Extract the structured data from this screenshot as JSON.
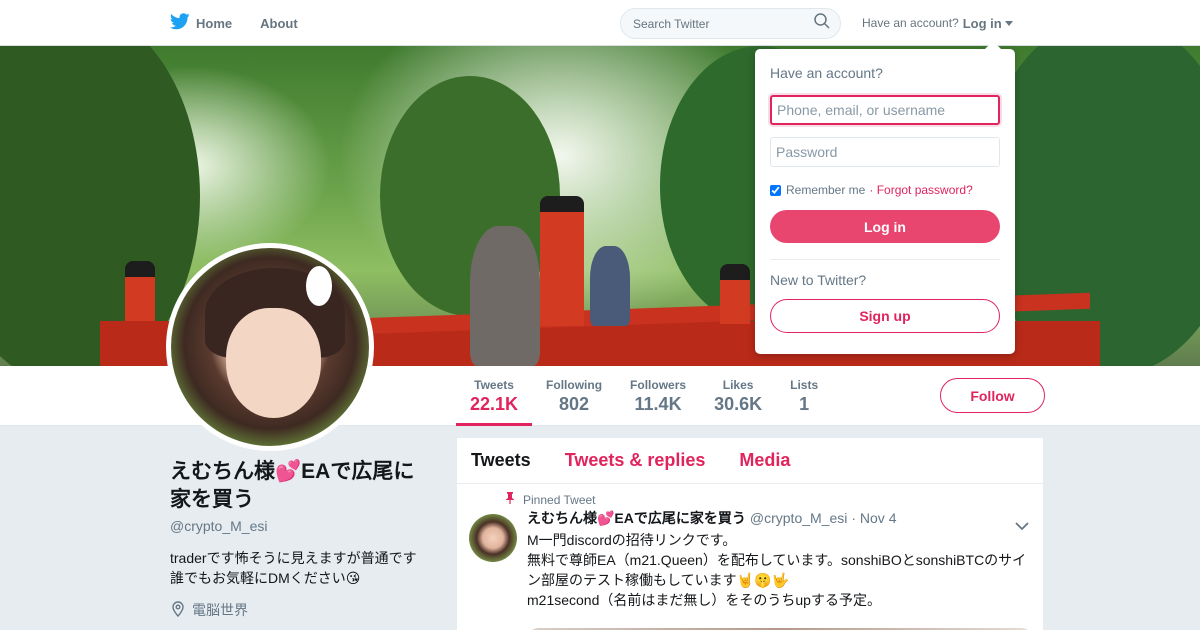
{
  "nav": {
    "home_label": "Home",
    "about_label": "About",
    "search_placeholder": "Search Twitter",
    "have_account_text": "Have an account?",
    "login_label": "Log in"
  },
  "colors": {
    "accent": "#e0245e",
    "brand_blue": "#1da1f2"
  },
  "icons": [
    "twitter-bird-icon",
    "search-icon",
    "caret-down-icon",
    "location-pin-icon",
    "pushpin-icon",
    "chevron-down-icon"
  ],
  "profile": {
    "name": "えむちん様💕EAで広尾に家を買う",
    "handle": "@crypto_M_esi",
    "bio": "traderです怖そうに見えますが普通です誰でもお気軽にDMください😘",
    "location": "電脳世界"
  },
  "stats": [
    {
      "label": "Tweets",
      "value": "22.1K"
    },
    {
      "label": "Following",
      "value": "802"
    },
    {
      "label": "Followers",
      "value": "11.4K"
    },
    {
      "label": "Likes",
      "value": "30.6K"
    },
    {
      "label": "Lists",
      "value": "1"
    }
  ],
  "follow_label": "Follow",
  "timeline": {
    "tabs": [
      "Tweets",
      "Tweets & replies",
      "Media"
    ],
    "pinned_label": "Pinned Tweet",
    "tweet": {
      "name": "えむちん様💕EAで広尾に家を買う",
      "handle": "@crypto_M_esi",
      "time": "· Nov 4",
      "text": "M一門discordの招待リンクです。\n無料で尊師EA（m21.Queen）を配布しています。sonshiBOとsonshiBTCのサイン部屋のテスト稼働もしています🤘🤫🤟\nm21second（名前はまだ無し）をそのうちupする予定。"
    }
  },
  "login_dropdown": {
    "title": "Have an account?",
    "username_placeholder": "Phone, email, or username",
    "password_placeholder": "Password",
    "remember_label": "Remember me",
    "forgot_label": "· Forgot password?",
    "login_button": "Log in",
    "new_text": "New to Twitter?",
    "signup_button": "Sign up"
  }
}
